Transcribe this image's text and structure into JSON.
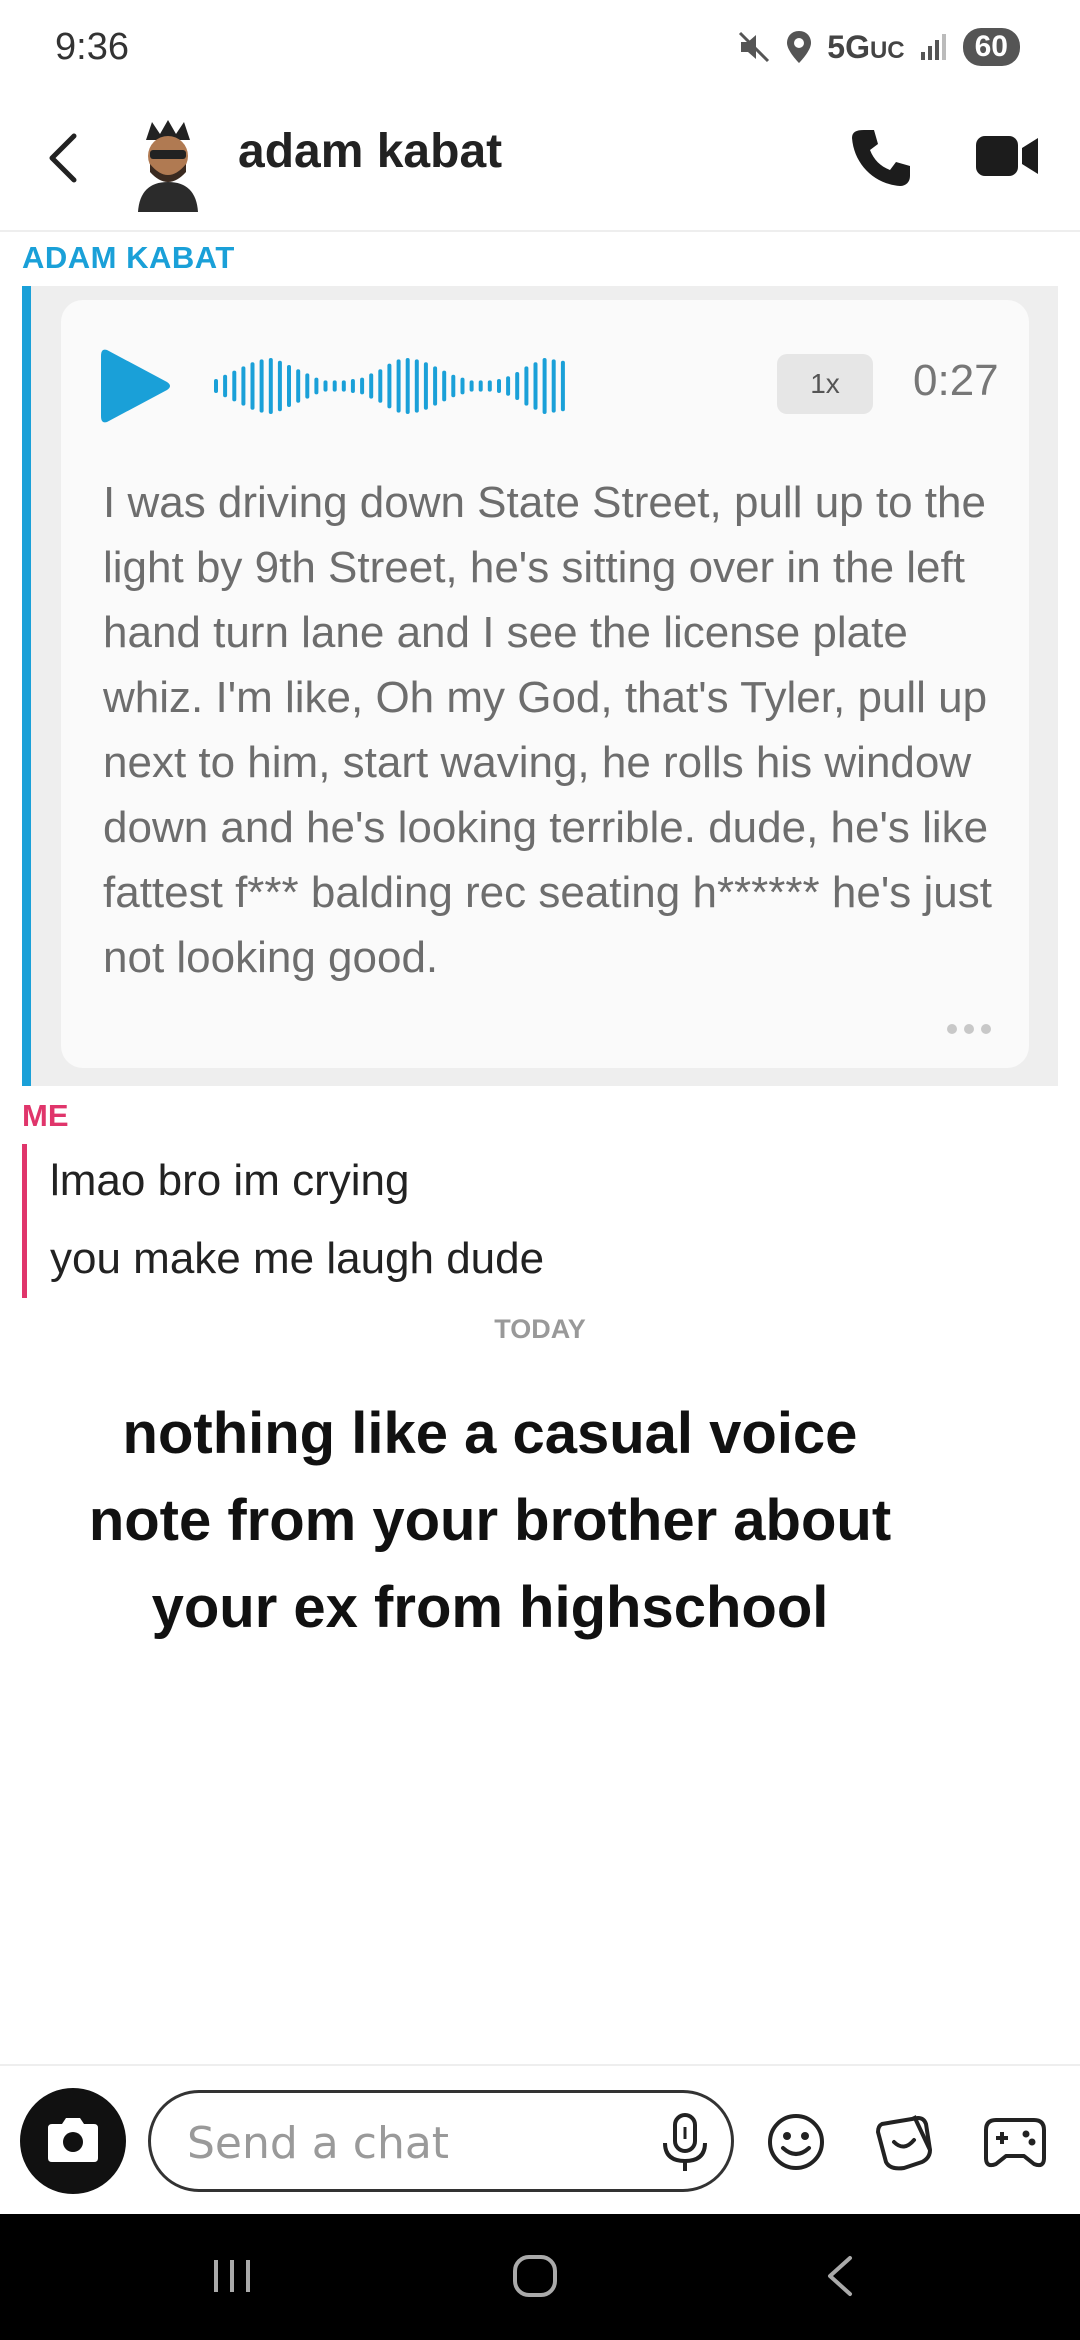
{
  "status_bar": {
    "time": "9:36",
    "network": "5G",
    "network_sub": "UC",
    "battery": "60",
    "icons": [
      "mute-icon",
      "location-icon",
      "signal-icon",
      "battery-icon"
    ]
  },
  "header": {
    "contact_name": "adam kabat",
    "icons": [
      "back-icon",
      "avatar",
      "phone-icon",
      "video-icon"
    ]
  },
  "conversation": {
    "sender_label": "ADAM KABAT",
    "voice_note": {
      "speed": "1x",
      "duration": "0:27",
      "transcript": "I was driving down State Street, pull up to the light by 9th Street, he's sitting over in the left hand turn lane and I see the license plate whiz. I'm like, Oh my God, that's Tyler, pull up next to him, start waving, he rolls his window down and he's looking terrible. dude, he's like fattest f*** balding rec seating h****** he's just not looking good."
    },
    "me_label": "ME",
    "me_messages": [
      "lmao bro im crying",
      "you make me laugh dude"
    ],
    "date_divider": "TODAY"
  },
  "overlay_caption": "nothing like a casual voice note from your brother about your ex from highschool",
  "composer": {
    "placeholder": "Send a chat",
    "icons": [
      "camera-icon",
      "mic-icon",
      "emoji-icon",
      "sticker-icon",
      "game-controller-icon"
    ]
  },
  "colors": {
    "sender_accent": "#1aa0d8",
    "me_accent": "#e0356b",
    "background": "#ffffff"
  }
}
